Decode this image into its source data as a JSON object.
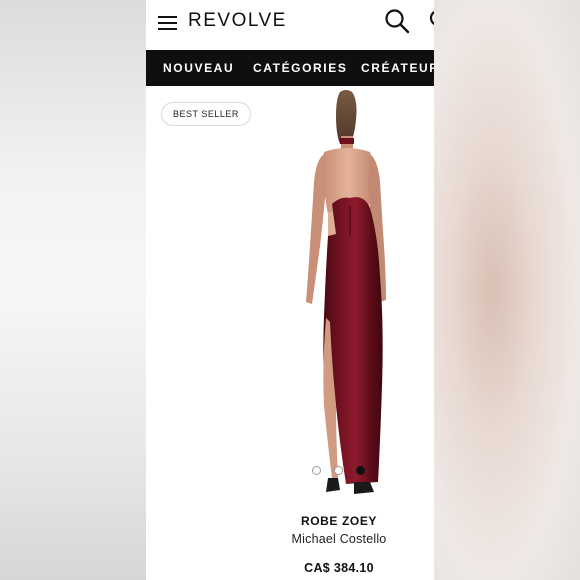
{
  "header": {
    "logo": "REVOLVE"
  },
  "icons": {
    "menu": "hamburger-menu-icon",
    "search": "search-icon",
    "partial": "cut-off-icon"
  },
  "nav": {
    "items": [
      {
        "label": "NOUVEAU"
      },
      {
        "label": "CATÉGORIES"
      },
      {
        "label": "CRÉATEURS"
      }
    ]
  },
  "product": {
    "badge": "BEST SELLER",
    "name": "ROBE ZOEY",
    "designer": "Michael Costello",
    "price": "CA$ 384.10",
    "dress_color": "#6e0f1e",
    "carousel": {
      "total_images": 3,
      "active_index": 3
    }
  },
  "colors": {
    "nav_background": "#0f0f0f",
    "text": "#111111"
  }
}
